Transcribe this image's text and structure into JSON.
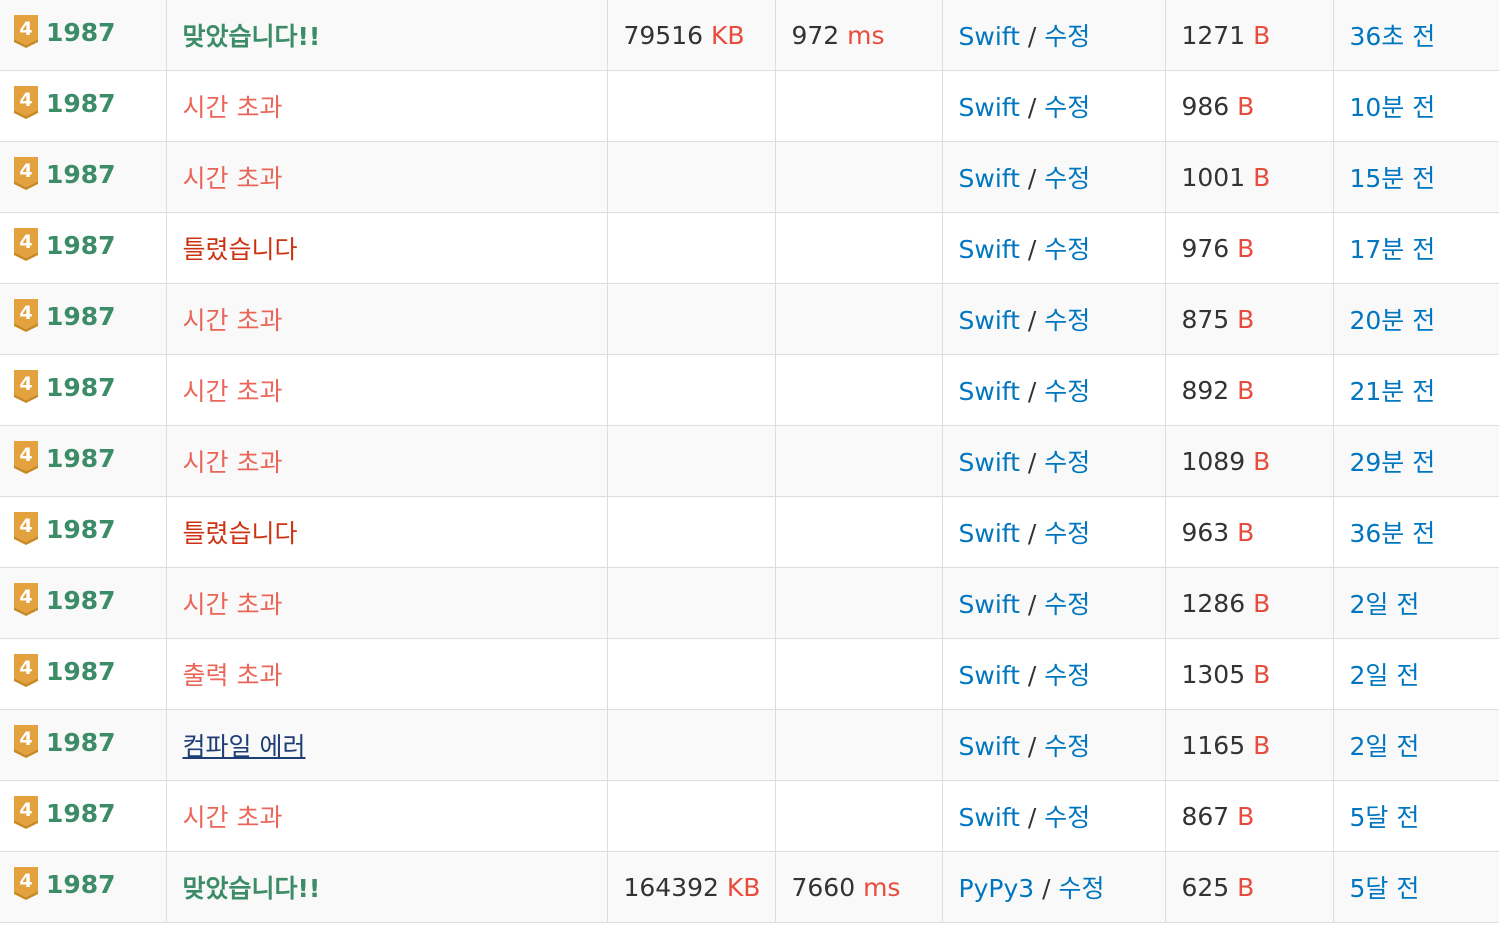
{
  "status_table": {
    "tier_badge_number": "4",
    "rows": [
      {
        "problem": "1987",
        "result": "맞았습니다!!",
        "result_type": "ac",
        "memory": "79516",
        "memory_unit": "KB",
        "time": "972",
        "time_unit": "ms",
        "language": "Swift",
        "edit": "수정",
        "code_length": "1271",
        "code_unit": "B",
        "submitted": "36초 전"
      },
      {
        "problem": "1987",
        "result": "시간 초과",
        "result_type": "tle",
        "memory": "",
        "memory_unit": "",
        "time": "",
        "time_unit": "",
        "language": "Swift",
        "edit": "수정",
        "code_length": "986",
        "code_unit": "B",
        "submitted": "10분 전"
      },
      {
        "problem": "1987",
        "result": "시간 초과",
        "result_type": "tle",
        "memory": "",
        "memory_unit": "",
        "time": "",
        "time_unit": "",
        "language": "Swift",
        "edit": "수정",
        "code_length": "1001",
        "code_unit": "B",
        "submitted": "15분 전"
      },
      {
        "problem": "1987",
        "result": "틀렸습니다",
        "result_type": "wa",
        "memory": "",
        "memory_unit": "",
        "time": "",
        "time_unit": "",
        "language": "Swift",
        "edit": "수정",
        "code_length": "976",
        "code_unit": "B",
        "submitted": "17분 전"
      },
      {
        "problem": "1987",
        "result": "시간 초과",
        "result_type": "tle",
        "memory": "",
        "memory_unit": "",
        "time": "",
        "time_unit": "",
        "language": "Swift",
        "edit": "수정",
        "code_length": "875",
        "code_unit": "B",
        "submitted": "20분 전"
      },
      {
        "problem": "1987",
        "result": "시간 초과",
        "result_type": "tle",
        "memory": "",
        "memory_unit": "",
        "time": "",
        "time_unit": "",
        "language": "Swift",
        "edit": "수정",
        "code_length": "892",
        "code_unit": "B",
        "submitted": "21분 전"
      },
      {
        "problem": "1987",
        "result": "시간 초과",
        "result_type": "tle",
        "memory": "",
        "memory_unit": "",
        "time": "",
        "time_unit": "",
        "language": "Swift",
        "edit": "수정",
        "code_length": "1089",
        "code_unit": "B",
        "submitted": "29분 전"
      },
      {
        "problem": "1987",
        "result": "틀렸습니다",
        "result_type": "wa",
        "memory": "",
        "memory_unit": "",
        "time": "",
        "time_unit": "",
        "language": "Swift",
        "edit": "수정",
        "code_length": "963",
        "code_unit": "B",
        "submitted": "36분 전"
      },
      {
        "problem": "1987",
        "result": "시간 초과",
        "result_type": "tle",
        "memory": "",
        "memory_unit": "",
        "time": "",
        "time_unit": "",
        "language": "Swift",
        "edit": "수정",
        "code_length": "1286",
        "code_unit": "B",
        "submitted": "2일 전"
      },
      {
        "problem": "1987",
        "result": "출력 초과",
        "result_type": "ole",
        "memory": "",
        "memory_unit": "",
        "time": "",
        "time_unit": "",
        "language": "Swift",
        "edit": "수정",
        "code_length": "1305",
        "code_unit": "B",
        "submitted": "2일 전"
      },
      {
        "problem": "1987",
        "result": "컴파일 에러",
        "result_type": "ce",
        "memory": "",
        "memory_unit": "",
        "time": "",
        "time_unit": "",
        "language": "Swift",
        "edit": "수정",
        "code_length": "1165",
        "code_unit": "B",
        "submitted": "2일 전"
      },
      {
        "problem": "1987",
        "result": "시간 초과",
        "result_type": "tle",
        "memory": "",
        "memory_unit": "",
        "time": "",
        "time_unit": "",
        "language": "Swift",
        "edit": "수정",
        "code_length": "867",
        "code_unit": "B",
        "submitted": "5달 전"
      },
      {
        "problem": "1987",
        "result": "맞았습니다!!",
        "result_type": "ac",
        "memory": "164392",
        "memory_unit": "KB",
        "time": "7660",
        "time_unit": "ms",
        "language": "PyPy3",
        "edit": "수정",
        "code_length": "625",
        "code_unit": "B",
        "submitted": "5달 전"
      }
    ]
  },
  "colors": {
    "accepted": "#3c8c68",
    "time_limit": "#e74c3c",
    "wrong": "#cc3311",
    "compile_error": "#1e3f74",
    "link": "#0076c0",
    "unit": "#e74c3c",
    "tier_badge": "#e3a23d"
  }
}
